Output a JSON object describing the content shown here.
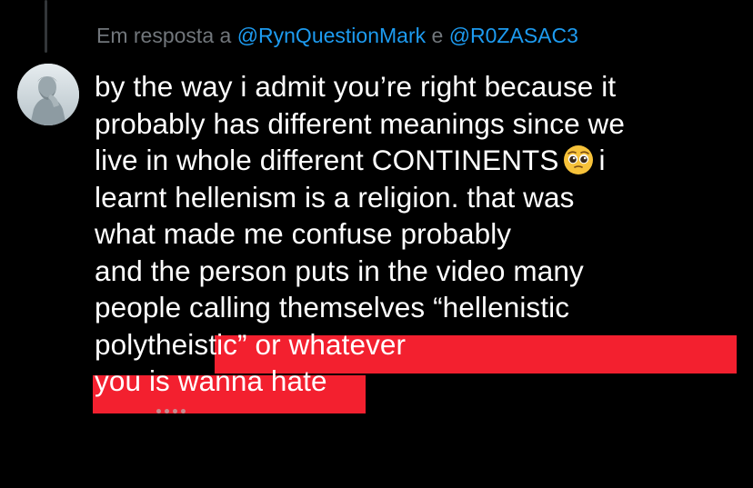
{
  "reply": {
    "prefix": "Em resposta a",
    "mention_1": "@RynQuestionMark",
    "conjunction": "e",
    "mention_2": "@R0ZASAC3"
  },
  "avatar": {
    "icon": "statue-avatar-icon"
  },
  "tweet": {
    "lines": [
      "by the way i admit you’re right because it",
      "probably has different meanings since we",
      "live in whole different CONTINENTS",
      "i",
      "learnt hellenism is a religion. that was",
      "what made me confuse probably",
      "and the person puts in the video many",
      "people calling themselves “hellenistic",
      "polythei",
      "stic” or whatever",
      "you is wanna hate"
    ],
    "emoji": "pleading-face-emoji"
  },
  "colors": {
    "background": "#000000",
    "text": "#ffffff",
    "muted": "#71767b",
    "mention": "#1d9bf0",
    "highlight": "#f3202f"
  }
}
